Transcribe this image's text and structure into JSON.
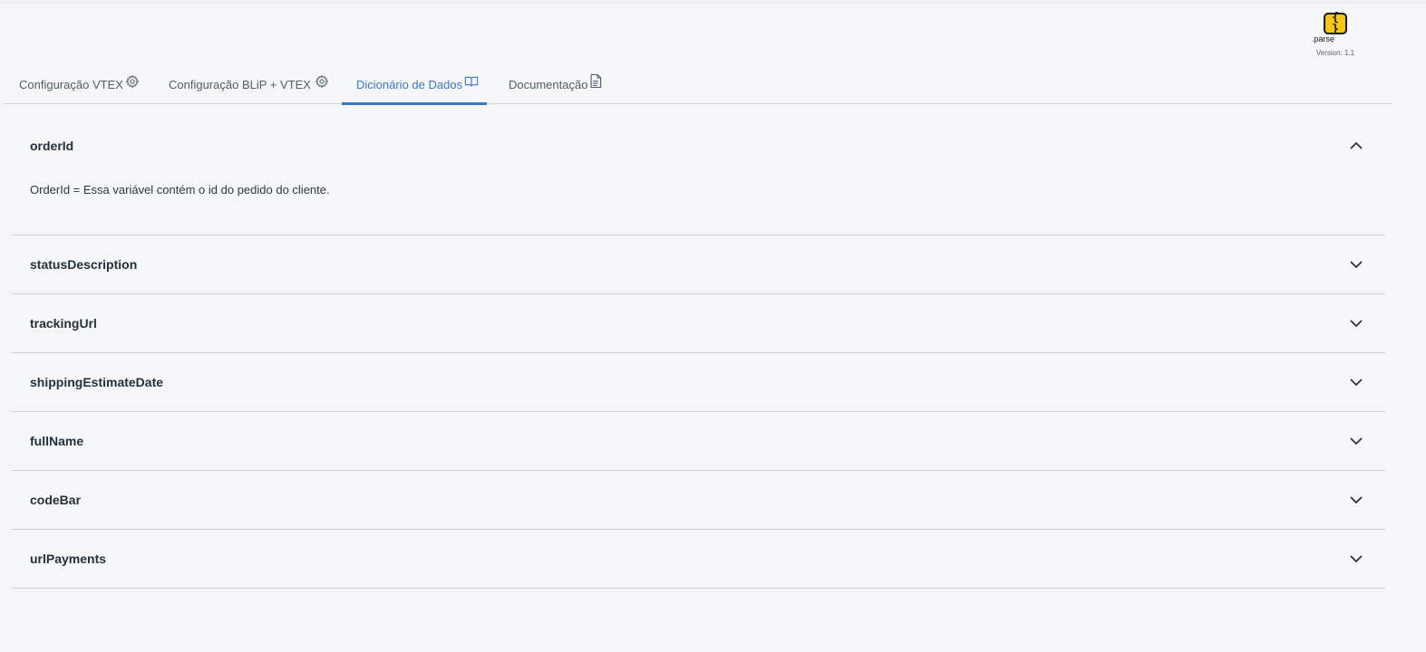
{
  "logo": {
    "text": ".parse",
    "version": "Version: 1.1"
  },
  "tabs": [
    {
      "label": "Configuração VTEX",
      "icon": "gear-icon",
      "active": false
    },
    {
      "label": "Configuração BLiP + VTEX",
      "icon": "gear-icon",
      "active": false
    },
    {
      "label": "Dicionário de Dados",
      "icon": "book-icon",
      "active": true
    },
    {
      "label": "Documentação",
      "icon": "document-icon",
      "active": false
    }
  ],
  "colors": {
    "accent": "#3c78c3",
    "background": "#f4f6f8",
    "divider": "#c6d0d6"
  },
  "accordion": [
    {
      "title": "orderId",
      "expanded": true,
      "body": "OrderId = Essa variável contém o id do pedido do cliente."
    },
    {
      "title": "statusDescription",
      "expanded": false
    },
    {
      "title": "trackingUrl",
      "expanded": false
    },
    {
      "title": "shippingEstimateDate",
      "expanded": false
    },
    {
      "title": "fullName",
      "expanded": false
    },
    {
      "title": "codeBar",
      "expanded": false
    },
    {
      "title": "urlPayments",
      "expanded": false
    }
  ]
}
